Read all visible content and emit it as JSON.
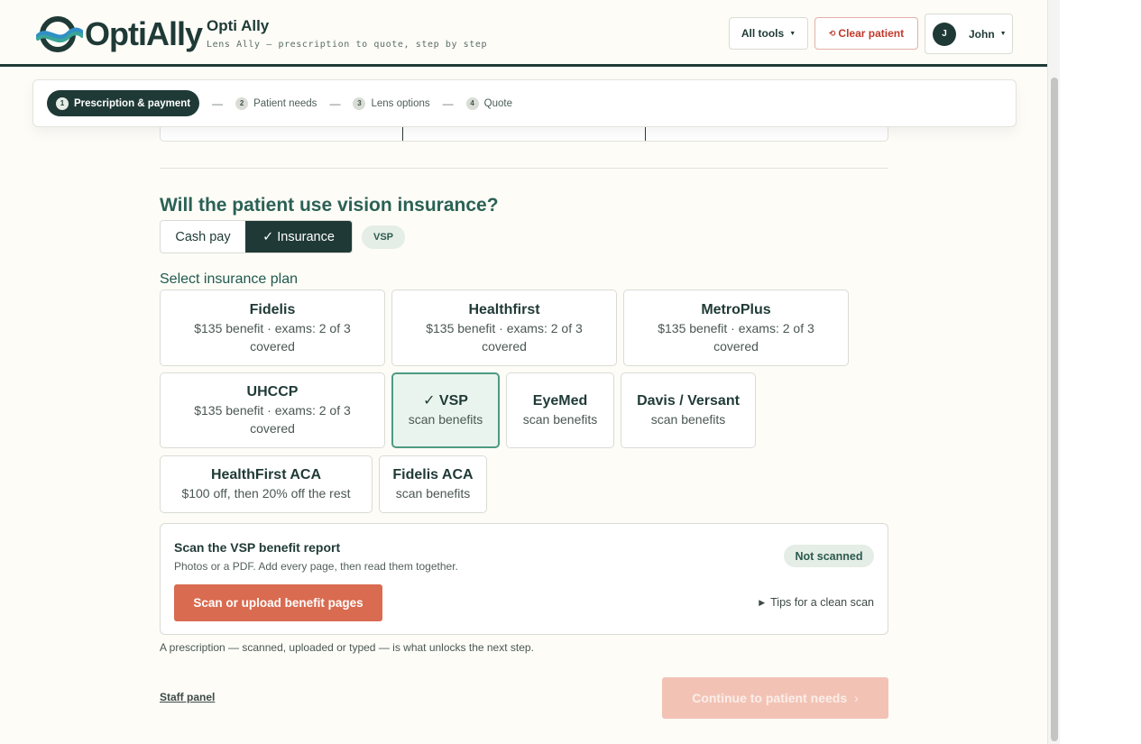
{
  "brand": {
    "logo_text": "OptiAlly",
    "app_title": "Opti Ally",
    "app_subtitle": "Lens Ally — prescription to quote, step by step"
  },
  "header": {
    "tools_label": "All tools",
    "clear_label": "Clear patient",
    "clear_icon": "circle-arrow-icon",
    "user_initial": "J",
    "user_name": "John"
  },
  "stepper": {
    "steps": [
      {
        "num": "1",
        "label": "Prescription & payment",
        "active": true
      },
      {
        "num": "2",
        "label": "Patient needs"
      },
      {
        "num": "3",
        "label": "Lens options"
      },
      {
        "num": "4",
        "label": "Quote"
      }
    ],
    "separator": "—"
  },
  "insurance": {
    "question": "Will the patient use vision insurance?",
    "cash_label": "Cash pay",
    "insurance_label": "✓ Insurance",
    "selected_pill": "VSP",
    "plan_label": "Select insurance plan",
    "plans": [
      {
        "name": "Fidelis",
        "desc": "$135 benefit · exams: 2 of 3 covered"
      },
      {
        "name": "Healthfirst",
        "desc": "$135 benefit · exams: 2 of 3 covered"
      },
      {
        "name": "MetroPlus",
        "desc": "$135 benefit · exams: 2 of 3 covered"
      },
      {
        "name": "UHCCP",
        "desc": "$135 benefit · exams: 2 of 3 covered"
      },
      {
        "name": "✓ VSP",
        "desc": "scan benefits",
        "selected": true
      },
      {
        "name": "EyeMed",
        "desc": "scan benefits"
      },
      {
        "name": "Davis / Versant",
        "desc": "scan benefits"
      },
      {
        "name": "HealthFirst ACA",
        "desc": "$100 off, then 20% off the rest"
      },
      {
        "name": "Fidelis ACA",
        "desc": "scan benefits"
      }
    ]
  },
  "scan": {
    "title": "Scan the VSP benefit report",
    "subtitle": "Photos or a PDF. Add every page, then read them together.",
    "status": "Not scanned",
    "button": "Scan or upload benefit pages",
    "tips": "Tips for a clean scan"
  },
  "footer": {
    "note": "A prescription — scanned, uploaded or typed — is what unlocks the next step.",
    "staff_link": "Staff panel",
    "continue_label": "Continue to patient needs",
    "continue_chevron": "›"
  },
  "colors": {
    "brand_dark": "#1f3a36",
    "accent_orange": "#d96b50",
    "accent_teal": "#4e9a82",
    "logo_blue": "#2f8fc6",
    "logo_teal": "#3aa597"
  }
}
